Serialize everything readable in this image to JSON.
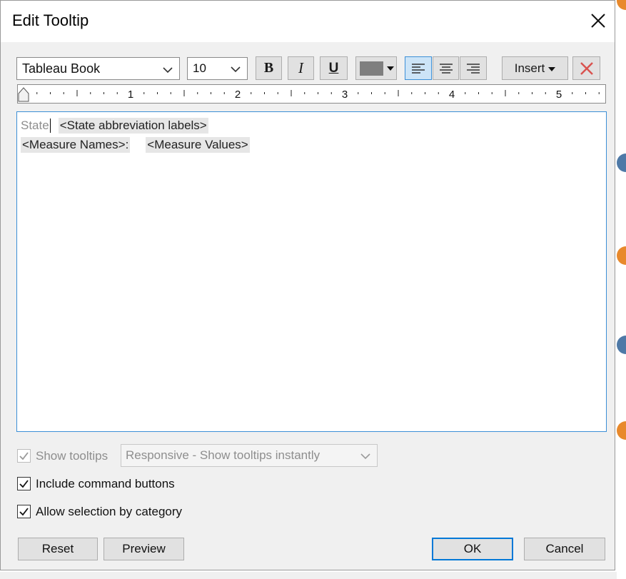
{
  "window": {
    "title": "Edit Tooltip"
  },
  "toolbar": {
    "font_name": "Tableau Book",
    "font_size": "10",
    "bold_label": "B",
    "italic_label": "I",
    "underline_label": "U",
    "text_color": "#7f7f7f",
    "insert_label": "Insert",
    "clear_icon": "red-x-icon"
  },
  "ruler": {
    "numbers": [
      "1",
      "2",
      "3",
      "4",
      "5"
    ]
  },
  "editor": {
    "line1_label": "State",
    "line1_field": "<State abbreviation labels>",
    "line2_label": "<Measure Names>:",
    "line2_field": "<Measure Values>"
  },
  "options": {
    "show_tooltips_label": "Show tooltips",
    "show_tooltips_checked": true,
    "tooltip_mode": "Responsive - Show tooltips instantly",
    "include_command_buttons_label": "Include command buttons",
    "include_command_buttons_checked": true,
    "allow_selection_label": "Allow selection by category",
    "allow_selection_checked": true
  },
  "buttons": {
    "reset": "Reset",
    "preview": "Preview",
    "ok": "OK",
    "cancel": "Cancel"
  },
  "colors": {
    "accent": "#0078d7",
    "focus_border": "#3c8fd6",
    "background_marks": "#e8892c",
    "background_marks_alt": "#4e79a7",
    "clear_red": "#d9534f"
  }
}
